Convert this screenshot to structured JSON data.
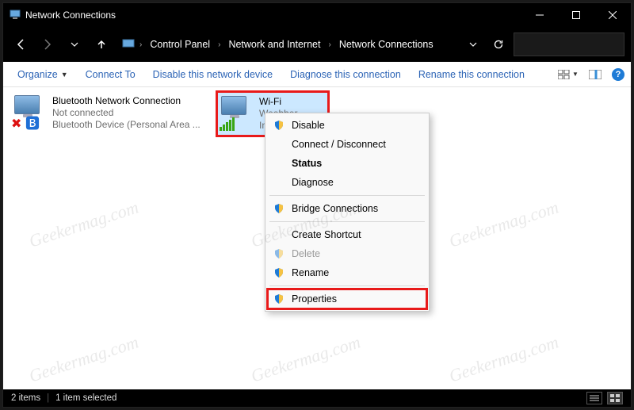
{
  "title": "Network Connections",
  "breadcrumbs": [
    "Control Panel",
    "Network and Internet",
    "Network Connections"
  ],
  "commands": {
    "organize": "Organize",
    "connect_to": "Connect To",
    "disable": "Disable this network device",
    "diagnose": "Diagnose this connection",
    "rename": "Rename this connection"
  },
  "items": {
    "bt": {
      "title": "Bluetooth Network Connection",
      "status": "Not connected",
      "device": "Bluetooth Device (Personal Area ..."
    },
    "wifi": {
      "title": "Wi-Fi",
      "status": "Weebber",
      "device": "Intel(R) D"
    }
  },
  "context_menu": {
    "disable": "Disable",
    "connect": "Connect / Disconnect",
    "status": "Status",
    "diagnose": "Diagnose",
    "bridge": "Bridge Connections",
    "shortcut": "Create Shortcut",
    "delete": "Delete",
    "rename": "Rename",
    "properties": "Properties"
  },
  "statusbar": {
    "count": "2 items",
    "selected": "1 item selected"
  },
  "watermark": "Geekermag.com",
  "colors": {
    "highlight": "#e81a1a",
    "selection": "#cce8ff"
  }
}
